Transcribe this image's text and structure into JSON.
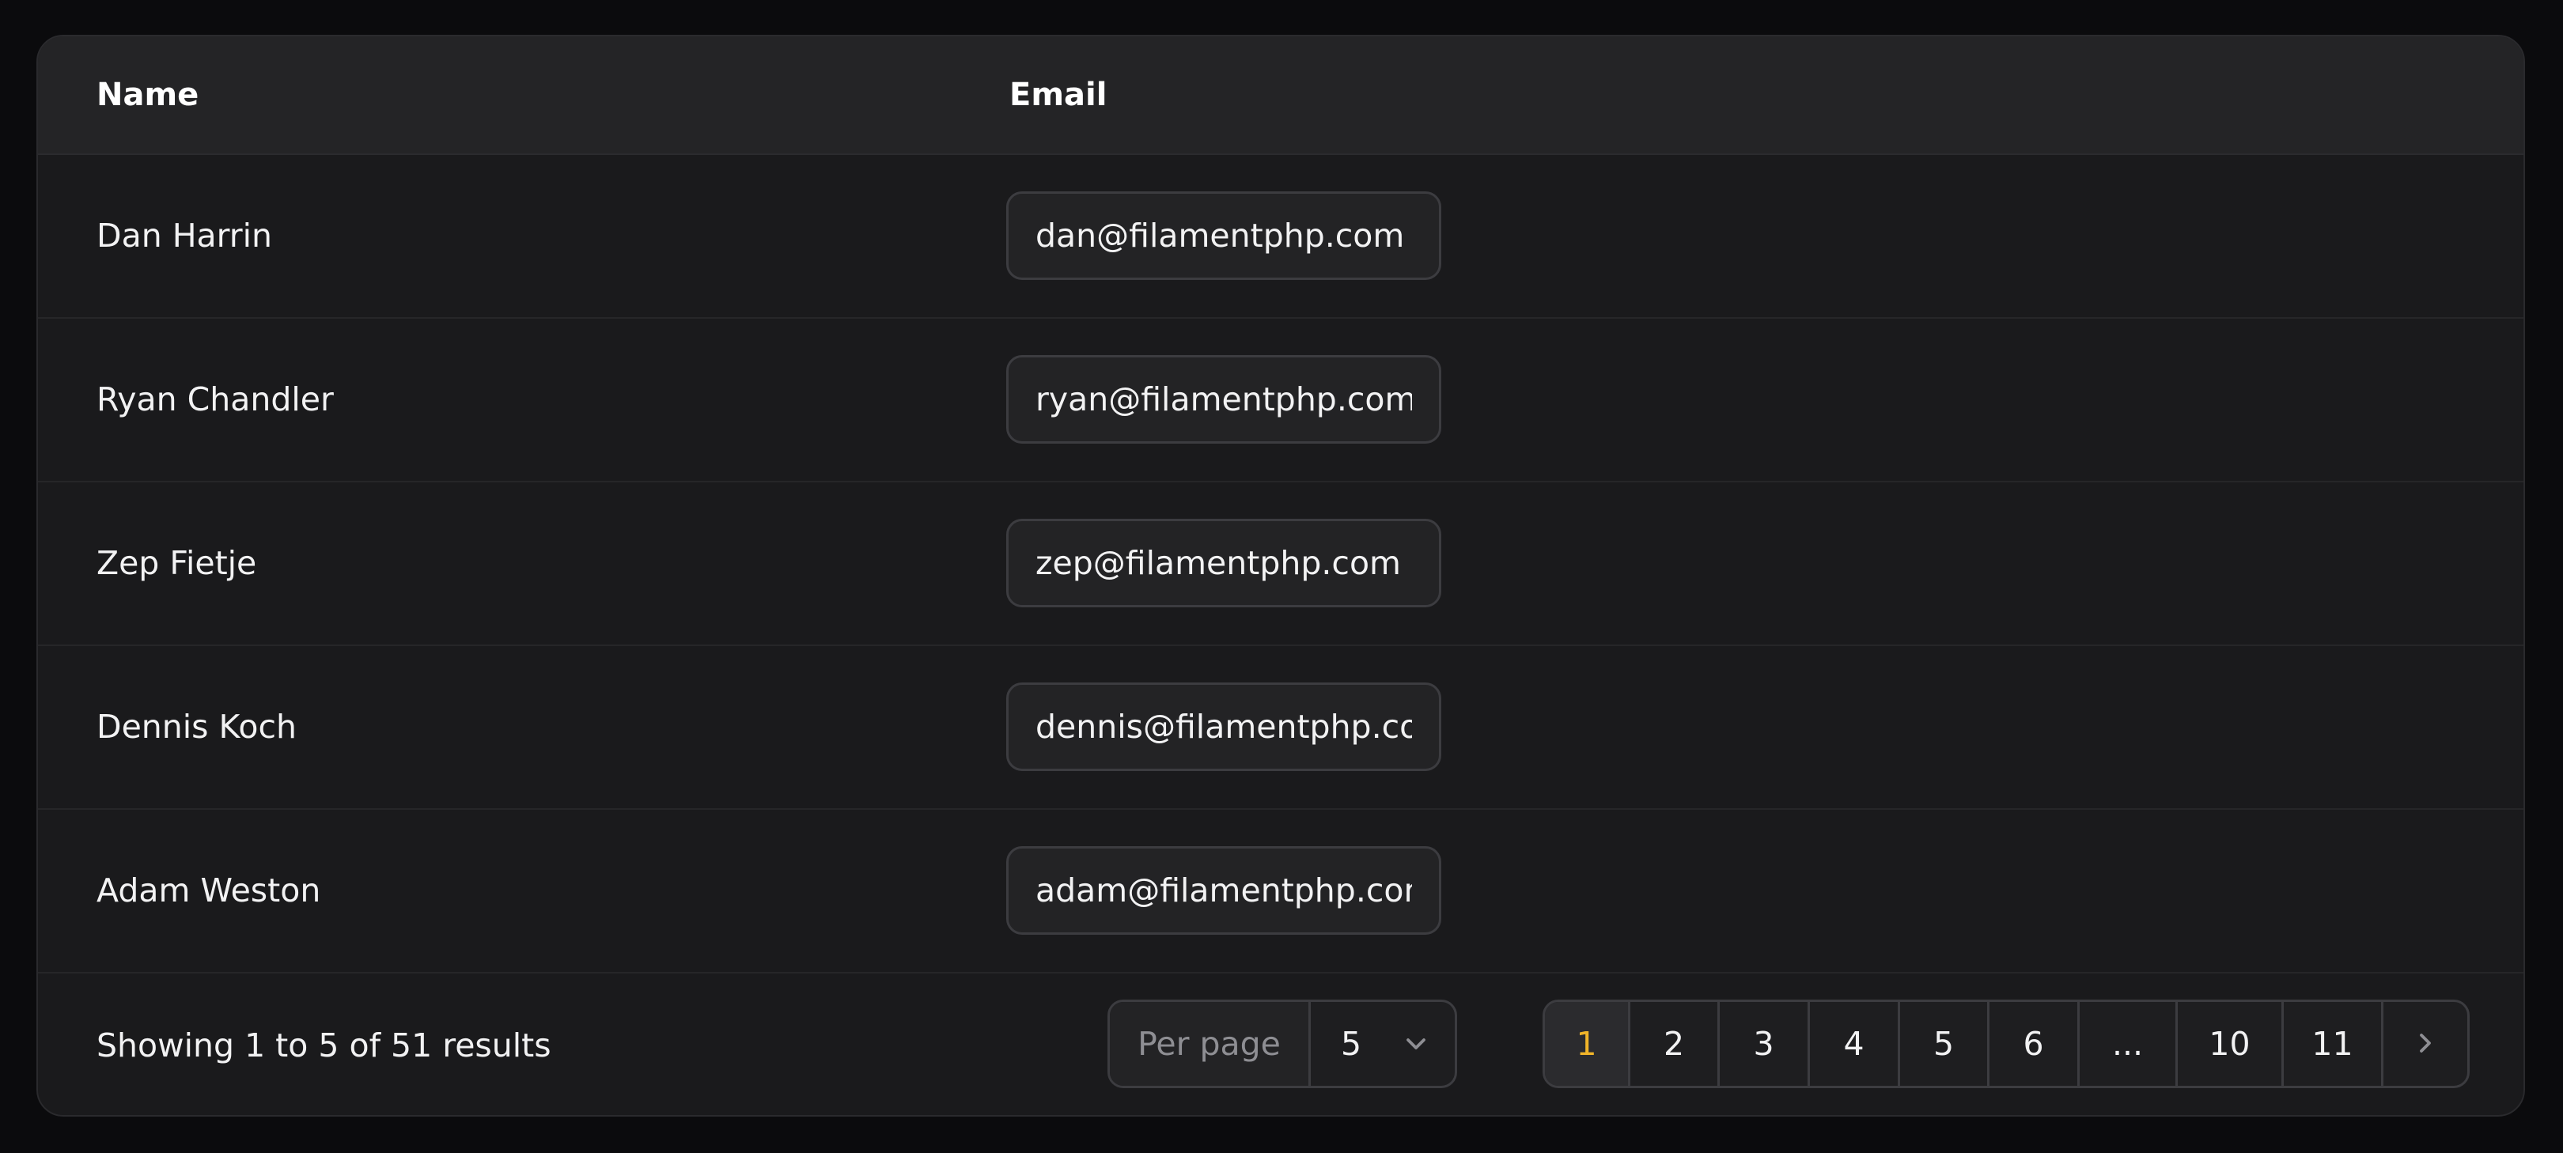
{
  "table": {
    "headers": {
      "name": "Name",
      "email": "Email"
    },
    "rows": [
      {
        "name": "Dan Harrin",
        "email": "dan@filamentphp.com"
      },
      {
        "name": "Ryan Chandler",
        "email": "ryan@filamentphp.com"
      },
      {
        "name": "Zep Fietje",
        "email": "zep@filamentphp.com"
      },
      {
        "name": "Dennis Koch",
        "email": "dennis@filamentphp.com"
      },
      {
        "name": "Adam Weston",
        "email": "adam@filamentphp.com"
      }
    ]
  },
  "footer": {
    "summary": "Showing 1 to 5 of 51 results",
    "per_page_label": "Per page",
    "per_page_value": "5",
    "pages": [
      "1",
      "2",
      "3",
      "4",
      "5",
      "6",
      "...",
      "10",
      "11"
    ],
    "current_page": "1"
  },
  "colors": {
    "accent": "#f0b429"
  },
  "icons": {
    "per_page_toggle": "chevron-down-icon",
    "next_page": "chevron-right-icon"
  }
}
